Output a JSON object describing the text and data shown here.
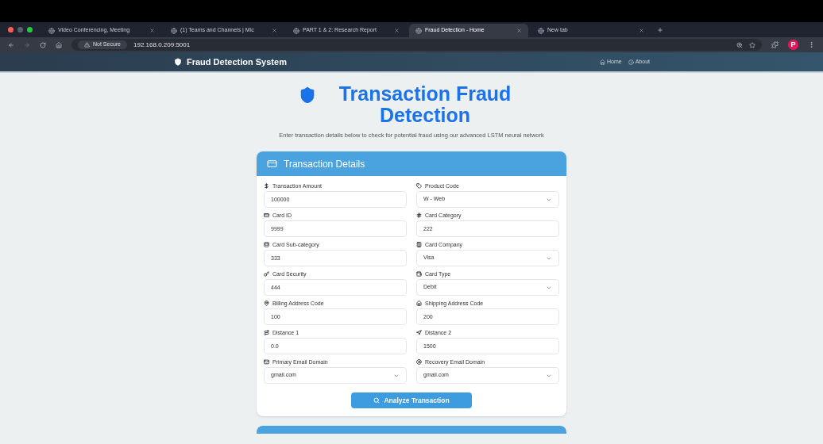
{
  "browser": {
    "tabs": [
      {
        "title": "Video Conferencing, Meeting",
        "selected": false
      },
      {
        "title": "(1) Teams and Channels | Mic",
        "selected": false
      },
      {
        "title": "PART 1 & 2: Research Report",
        "selected": false
      },
      {
        "title": "Fraud Detection - Home",
        "selected": true
      },
      {
        "title": "New tab",
        "selected": false
      }
    ],
    "security": "Not Secure",
    "url": "192.168.0.209:5001",
    "profile": "P"
  },
  "navbar": {
    "brand": "Fraud Detection System",
    "links": [
      "Home",
      "About"
    ]
  },
  "hero": {
    "title": "Transaction Fraud Detection",
    "subtitle": "Enter transaction details below to check for potential fraud using our advanced LSTM neural network"
  },
  "card": {
    "title": "Transaction Details",
    "fields": [
      {
        "label": "Transaction Amount",
        "kind": "input",
        "value": "100000"
      },
      {
        "label": "Product Code",
        "kind": "select",
        "value": "W - Web"
      },
      {
        "label": "Card ID",
        "kind": "input",
        "value": "9999"
      },
      {
        "label": "Card Category",
        "kind": "input",
        "value": "222"
      },
      {
        "label": "Card Sub-category",
        "kind": "input",
        "value": "333"
      },
      {
        "label": "Card Company",
        "kind": "select",
        "value": "Visa"
      },
      {
        "label": "Card Security",
        "kind": "input",
        "value": "444"
      },
      {
        "label": "Card Type",
        "kind": "select",
        "value": "Debit"
      },
      {
        "label": "Billing Address Code",
        "kind": "input",
        "value": "100"
      },
      {
        "label": "Shipping Address Code",
        "kind": "input",
        "value": "200"
      },
      {
        "label": "Distance 1",
        "kind": "input",
        "value": "0.0"
      },
      {
        "label": "Distance 2",
        "kind": "input",
        "value": "1500"
      },
      {
        "label": "Primary Email Domain",
        "kind": "select",
        "value": "gmail.com"
      },
      {
        "label": "Recovery Email Domain",
        "kind": "select",
        "value": "gmail.com"
      }
    ],
    "button": "Analyze Transaction"
  }
}
